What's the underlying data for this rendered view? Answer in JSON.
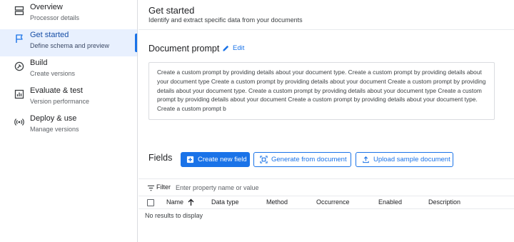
{
  "sidebar": {
    "items": [
      {
        "label": "Overview",
        "sub": "Processor details",
        "icon": "overview-icon"
      },
      {
        "label": "Get started",
        "sub": "Define schema and preview",
        "icon": "flag-icon"
      },
      {
        "label": "Build",
        "sub": "Create versions",
        "icon": "build-icon"
      },
      {
        "label": "Evaluate & test",
        "sub": "Version performance",
        "icon": "chart-icon"
      },
      {
        "label": "Deploy & use",
        "sub": "Manage versions",
        "icon": "broadcast-icon"
      }
    ],
    "active_index": 1
  },
  "header": {
    "title": "Get started",
    "subtitle": "Identify and extract specific data from your documents"
  },
  "prompt": {
    "title": "Document prompt",
    "edit_label": "Edit",
    "text": "Create a custom prompt by providing details about your document type. Create a custom prompt by providing details about your document type Create a custom prompt by providing details about your document Create a custom prompt by providing details about your document type. Create a custom prompt by providing details about your document type Create a custom prompt by providing details about your document Create a custom prompt by providing details about your document type. Create a custom prompt b"
  },
  "fields": {
    "title": "Fields",
    "create_label": "Create new field",
    "generate_label": "Generate from document",
    "upload_label": "Upload sample document"
  },
  "filter": {
    "label": "Filter",
    "placeholder": "Enter property name or value"
  },
  "table": {
    "columns": [
      "Name",
      "Data type",
      "Method",
      "Occurrence",
      "Enabled",
      "Description"
    ],
    "sort_column": "Name",
    "sort_direction": "ascending",
    "empty_text": "No results to display"
  },
  "colors": {
    "accent": "#1a73e8",
    "active_bg": "#e8f0fe"
  }
}
